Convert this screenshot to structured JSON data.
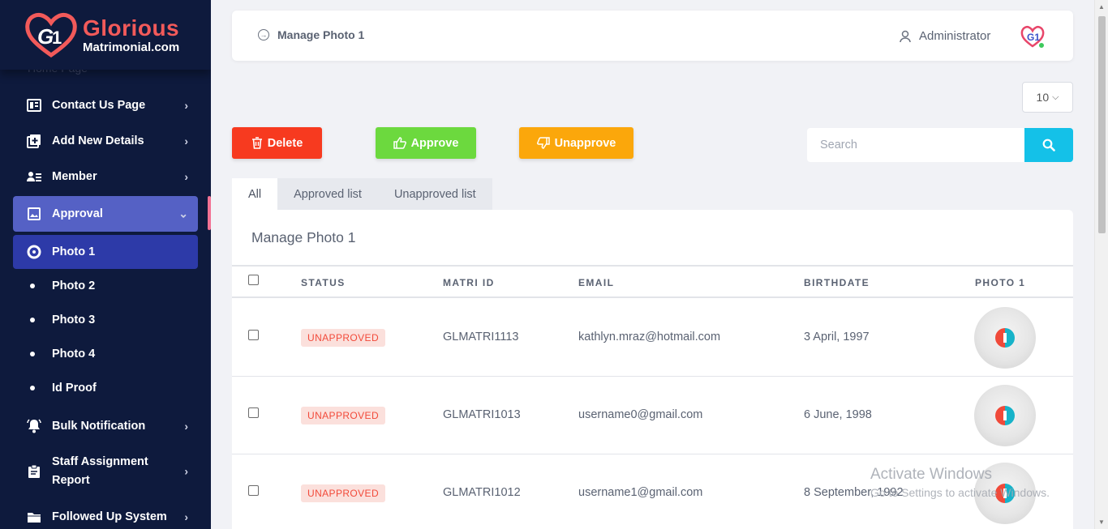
{
  "brand": {
    "name_line1": "Glorious",
    "name_line2": "Matrimonial.com",
    "accent": "#f25a5a"
  },
  "sidebar": {
    "ghost_item": "Home Page",
    "items": [
      {
        "label": "Contact Us Page",
        "icon": "contact-card-icon"
      },
      {
        "label": "Add New Details",
        "icon": "add-square-icon"
      },
      {
        "label": "Member",
        "icon": "members-icon"
      },
      {
        "label": "Approval",
        "icon": "image-approval-icon"
      },
      {
        "label": "Photo 1"
      },
      {
        "label": "Photo 2"
      },
      {
        "label": "Photo 3"
      },
      {
        "label": "Photo 4"
      },
      {
        "label": "Id Proof"
      },
      {
        "label": "Bulk Notification",
        "icon": "bell-icon"
      },
      {
        "label": "Staff Assignment",
        "label2": "Report",
        "icon": "clipboard-icon"
      },
      {
        "label": "Followed Up System",
        "icon": "folder-icon"
      }
    ]
  },
  "header": {
    "breadcrumb": "Manage Photo 1",
    "user": "Administrator"
  },
  "page_size": "10",
  "actions": {
    "delete": "Delete",
    "approve": "Approve",
    "unapprove": "Unapprove"
  },
  "search": {
    "placeholder": "Search",
    "value": ""
  },
  "tabs": [
    "All",
    "Approved list",
    "Unapproved list"
  ],
  "card": {
    "title": "Manage Photo 1",
    "columns": [
      "STATUS",
      "MATRI ID",
      "EMAIL",
      "BIRTHDATE",
      "PHOTO 1"
    ],
    "rows": [
      {
        "status": "UNAPPROVED",
        "matri_id": "GLMATRI1113",
        "email": "kathlyn.mraz@hotmail.com",
        "birthdate": "3 April, 1997"
      },
      {
        "status": "UNAPPROVED",
        "matri_id": "GLMATRI1013",
        "email": "username0@gmail.com",
        "birthdate": "6 June, 1998"
      },
      {
        "status": "UNAPPROVED",
        "matri_id": "GLMATRI1012",
        "email": "username1@gmail.com",
        "birthdate": "8 September, 1992"
      }
    ]
  },
  "watermark": {
    "line1": "Activate Windows",
    "line2": "Go to Settings to activate Windows."
  },
  "colors": {
    "delete": "#f73a1f",
    "approve": "#6cd93e",
    "unapprove": "#fba70b",
    "search_button": "#14c1e8",
    "sidebar_bg": "#0e1a3d",
    "active_item": "#5561c5"
  }
}
